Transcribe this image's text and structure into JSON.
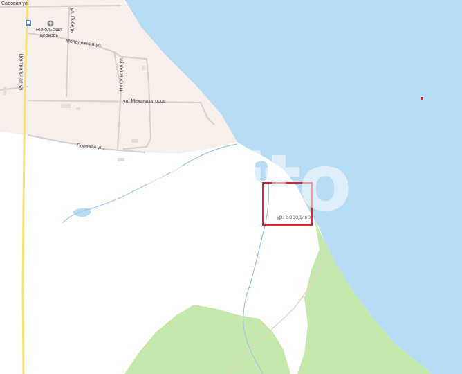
{
  "map": {
    "colors": {
      "water": "#b7dcf4",
      "settlement": "#f7efec",
      "land": "#ffffff",
      "forest": "#c5e9ac",
      "main_road": "#f6e27a",
      "street": "#d8d2cf",
      "stream": "#9cc6e6",
      "selection": "#e8202a",
      "point_marker": "#c8243a"
    },
    "streets": {
      "sadovaya": "Садовая ул.",
      "pobedy": "ул. Победы",
      "molodezhnaya": "Молодёжная ул.",
      "tsentralnaya": "Центральная ул.",
      "nikolskaya": "Никольская ул.",
      "mekhanizatorov": "ул. Механизаторов",
      "polevaya": "Полевая ул."
    },
    "church": {
      "line1": "Никольская",
      "line2": "церковь",
      "icon": "church-icon"
    },
    "bus_stop": {
      "icon": "bus-stop-icon"
    },
    "place": {
      "label": "ур. Бородино"
    },
    "watermark": "Avito"
  }
}
